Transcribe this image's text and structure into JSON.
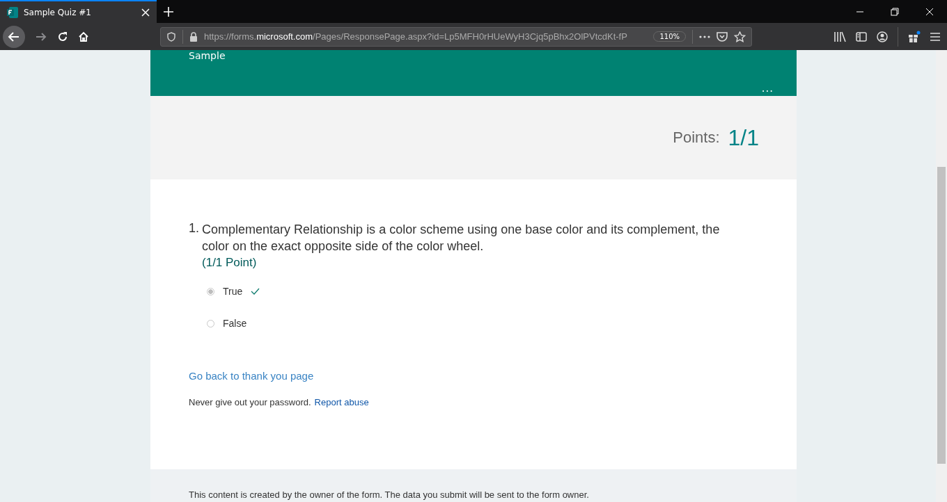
{
  "browser": {
    "tab": {
      "title": "Sample Quiz #1",
      "selected": true
    },
    "url_prefix": "https://forms.",
    "url_domain": "microsoft.com",
    "url_rest": "/Pages/ResponsePage.aspx?id=Lp5MFH0rHUeWyH3Cjq5pBhx2OlPVtcdKt-fP",
    "zoom": "110%"
  },
  "form": {
    "title": "Sample",
    "more": "...",
    "points_label": "Points:",
    "points_value": "1/1",
    "questions": [
      {
        "number": "1.",
        "text": "Complementary Relationship is a color scheme using one base color and its complement, the color on the exact opposite side of the color wheel.",
        "score": "(1/1 Point)",
        "options": [
          {
            "label": "True",
            "selected": true,
            "correct": true
          },
          {
            "label": "False",
            "selected": false,
            "correct": false
          }
        ]
      }
    ],
    "back_link": "Go back to thank you page",
    "notice": "Never give out your password.",
    "report_link": "Report abuse"
  },
  "footer": "This content is created by the owner of the form. The data you submit will be sent to the form owner."
}
